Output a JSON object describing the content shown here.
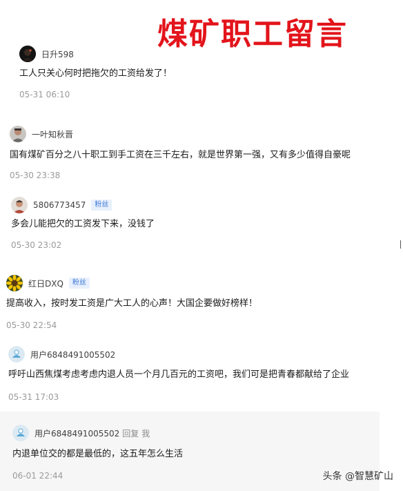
{
  "header": {
    "title": "煤矿职工留言"
  },
  "comments": [
    {
      "username": "日升598",
      "badge": "",
      "text": "工人只关心何时把拖欠的工资给发了！",
      "time": "05-31 06:10",
      "avatar": "dark-portrait-avatar"
    },
    {
      "username": "一叶知秋晋",
      "badge": "",
      "text": "国有煤矿百分之八十职工到手工资在三千左右，就是世界第一强，又有多少值得自豪呢",
      "time": "05-30 23:38",
      "avatar": "person-photo-avatar"
    },
    {
      "username": "5806773457",
      "badge": "粉丝",
      "text": "多会儿能把欠的工资发下来，没钱了",
      "time": "05-30 23:02",
      "avatar": "person-photo-avatar"
    },
    {
      "username": "红日DXQ",
      "badge": "粉丝",
      "text": "提高收入，按时发工资是广大工人的心声！大国企要做好榜样！",
      "time": "05-30 22:54",
      "avatar": "sunflower-avatar"
    },
    {
      "username": "用户6848491005502",
      "badge": "",
      "text": "呼吁山西焦煤考虑考虑内退人员一个月几百元的工资吧，我们可是把青春都献给了企业",
      "time": "05-31 17:03",
      "avatar": "default-avatar"
    }
  ],
  "reply": {
    "username": "用户6848491005502",
    "reply_word": "回复",
    "reply_target": "我",
    "text": "内退单位交的都是最低的，这五年怎么生活",
    "time": "06-01 22:44",
    "avatar": "default-avatar"
  },
  "watermark": {
    "text": "头条 @智慧矿山"
  },
  "colors": {
    "title": "#e3141b",
    "badge_text": "#3d7ad6",
    "badge_bg": "#e8f0fd"
  }
}
